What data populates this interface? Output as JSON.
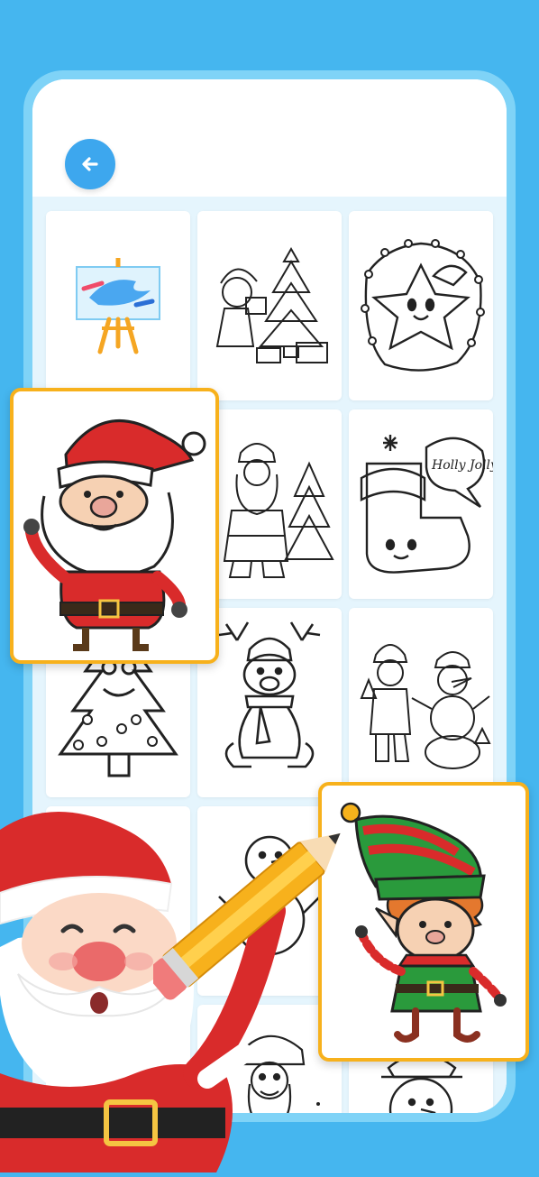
{
  "colors": {
    "background": "#45b6ef",
    "frame": "#7fd3f7",
    "grid_bg": "#e5f5fd",
    "accent_button": "#3da7ee",
    "card_border": "#f7b11c",
    "santa_red": "#d92b2b",
    "elf_green": "#2a9a3c"
  },
  "header": {
    "back_button_icon": "arrow-left-icon"
  },
  "grid": {
    "tiles": [
      {
        "name": "new-drawing-easel",
        "icon": "easel-icon"
      },
      {
        "name": "girl-christmas-tree"
      },
      {
        "name": "star-with-lights"
      },
      {
        "name": "santa-with-tree"
      },
      {
        "name": "holly-jolly-stocking",
        "text": "Holly Jolly"
      },
      {
        "name": "christmas-tree-face"
      },
      {
        "name": "reindeer-scarf"
      },
      {
        "name": "boy-and-snowman"
      },
      {
        "name": "snowman"
      },
      {
        "name": "santa-face"
      },
      {
        "name": "snowman-hat"
      }
    ]
  },
  "featured": {
    "left": "colored-santa",
    "right": "colored-elf"
  }
}
